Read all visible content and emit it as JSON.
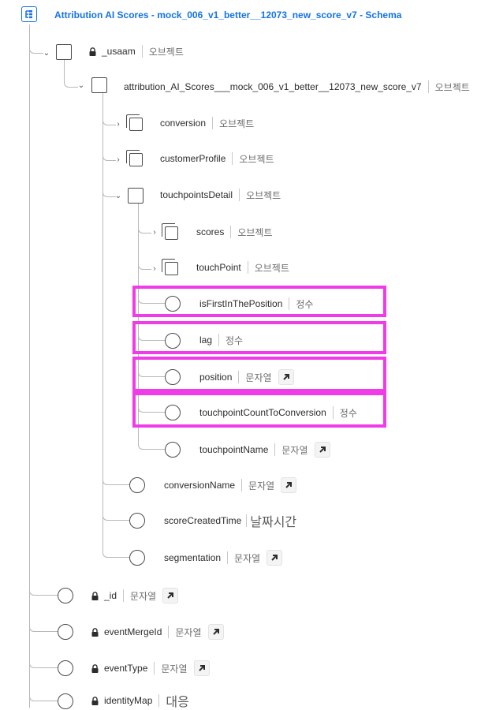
{
  "schema": {
    "title": "Attribution AI Scores - mock_006_v1_better__12073_new_score_v7 - Schema"
  },
  "colors": {
    "accent": "#1473e6",
    "highlight": "#f03ce8",
    "line": "#b8b8b8"
  },
  "icons": {
    "schema": "schema-tree-icon",
    "object": "object-node-icon",
    "array": "array-node-icon",
    "field": "field-circle-icon",
    "lock": "lock-icon",
    "reference": "arrow-up-right-icon",
    "expanded": "chevron-down-icon",
    "collapsed": "chevron-right-icon"
  },
  "tree": {
    "usaam": {
      "name": "_usaam",
      "type": "오브젝트"
    },
    "attribution": {
      "name": "attribution_AI_Scores___mock_006_v1_better__12073_new_score_v7",
      "type": "오브젝트"
    },
    "conversion": {
      "name": "conversion",
      "type": "오브젝트"
    },
    "customerProfile": {
      "name": "customerProfile",
      "type": "오브젝트"
    },
    "touchpointsDetail": {
      "name": "touchpointsDetail",
      "type": "오브젝트"
    },
    "scores": {
      "name": "scores",
      "type": "오브젝트"
    },
    "touchPoint": {
      "name": "touchPoint",
      "type": "오브젝트"
    },
    "isFirstInThePosition": {
      "name": "isFirstInThePosition",
      "type": "정수"
    },
    "lag": {
      "name": "lag",
      "type": "정수"
    },
    "position": {
      "name": "position",
      "type": "문자열"
    },
    "touchpointCountToConversion": {
      "name": "touchpointCountToConversion",
      "type": "정수"
    },
    "touchpointName": {
      "name": "touchpointName",
      "type": "문자열"
    },
    "conversionName": {
      "name": "conversionName",
      "type": "문자열"
    },
    "scoreCreatedTime": {
      "name": "scoreCreatedTime",
      "type": "날짜시간"
    },
    "segmentation": {
      "name": "segmentation",
      "type": "문자열"
    },
    "id": {
      "name": "_id",
      "type": "문자열"
    },
    "eventMergeId": {
      "name": "eventMergeId",
      "type": "문자열"
    },
    "eventType": {
      "name": "eventType",
      "type": "문자열"
    },
    "identityMap": {
      "name": "identityMap",
      "type": "대응"
    }
  }
}
